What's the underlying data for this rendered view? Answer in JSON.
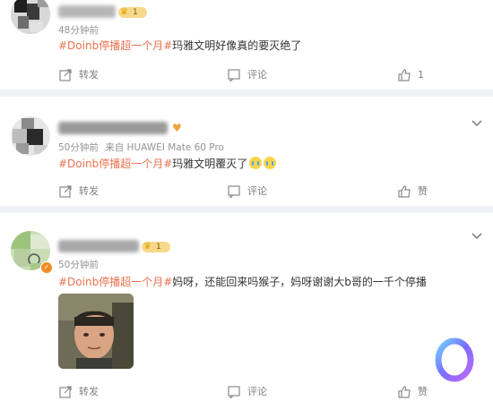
{
  "posts": [
    {
      "time": "48分钟前",
      "source": "",
      "level": "1",
      "hashtag": "#Doinb停播超一个月#",
      "text": "玛雅文明好像真的要灭绝了",
      "actions": {
        "repost": "转发",
        "comment": "评论",
        "like_count": "1"
      }
    },
    {
      "time": "50分钟前",
      "source": "来自 HUAWEI Mate 60 Pro",
      "hashtag": "#Doinb停播超一个月#",
      "text": "玛雅文明覆灭了",
      "emoji": "crying-face-emoji",
      "actions": {
        "repost": "转发",
        "comment": "评论",
        "like_label": "赞"
      }
    },
    {
      "time": "50分钟前",
      "level": "1",
      "hashtag": "#Doinb停播超一个月#",
      "text": "妈呀，还能回来吗猴子，妈呀谢谢大b哥的一千个停播",
      "actions": {
        "repost": "转发",
        "comment": "评论",
        "like_label": "赞"
      }
    }
  ],
  "colors": {
    "link": "#eb7350",
    "meta": "#939393",
    "divider": "#f1f2f5",
    "badge": "#f7d98c"
  }
}
